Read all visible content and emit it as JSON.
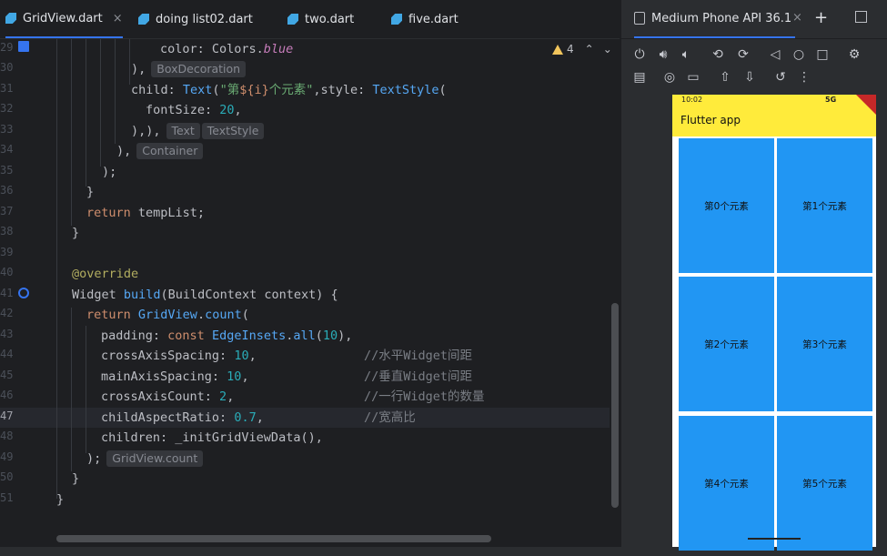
{
  "editor_tabs": [
    {
      "label": "GridView.dart",
      "active": true,
      "close": "×"
    },
    {
      "label": "doing list02.dart",
      "active": false
    },
    {
      "label": "two.dart",
      "active": false
    },
    {
      "label": "five.dart",
      "active": false
    }
  ],
  "warnings": {
    "count": "4"
  },
  "code": {
    "line_numbers": [
      "29",
      "30",
      "31",
      "32",
      "33",
      "34",
      "35",
      "36",
      "37",
      "38",
      "39",
      "40",
      "41",
      "42",
      "43",
      "44",
      "45",
      "46",
      "47",
      "48",
      "49",
      "50",
      "51"
    ],
    "current_line": "47",
    "hints": {
      "box_decoration": "BoxDecoration",
      "text": "Text",
      "text_style": "TextStyle",
      "container": "Container",
      "gridview_count": "GridView.count"
    },
    "l29": {
      "a": "color: Colors.",
      "b": "blue"
    },
    "l30": {
      "a": "),"
    },
    "l31": {
      "a": "child: ",
      "b": "Text",
      "c": "(",
      "d": "\"第",
      "e": "${i}",
      "f": "个元素\"",
      "g": ",style: ",
      "h": "TextStyle",
      "i": "("
    },
    "l32": {
      "a": "fontSize: ",
      "b": "20",
      "c": ","
    },
    "l33": {
      "a": "),),"
    },
    "l34": {
      "a": "),"
    },
    "l35": {
      "a": ");"
    },
    "l36": {
      "a": "}"
    },
    "l37": {
      "a": "return",
      "b": " tempList;"
    },
    "l38": {
      "a": "}"
    },
    "l40": {
      "a": "@override"
    },
    "l41": {
      "a": "Widget ",
      "b": "build",
      "c": "(BuildContext context) {"
    },
    "l42": {
      "a": "return ",
      "b": "GridView",
      "c": ".",
      "d": "count",
      "e": "("
    },
    "l43": {
      "a": "padding: ",
      "b": "const ",
      "c": "EdgeInsets",
      "d": ".",
      "e": "all",
      "f": "(",
      "g": "10",
      "h": "),"
    },
    "l44": {
      "a": "crossAxisSpacing: ",
      "b": "10",
      "c": ",",
      "d": "//水平Widget间距"
    },
    "l45": {
      "a": "mainAxisSpacing: ",
      "b": "10",
      "c": ",",
      "d": "//垂直Widget间距"
    },
    "l46": {
      "a": "crossAxisCount: ",
      "b": "2",
      "c": ",",
      "d": "//一行Widget的数量"
    },
    "l47": {
      "a": "childAspectRatio: ",
      "b": "0.7",
      "c": ",",
      "d": "//宽高比"
    },
    "l48": {
      "a": "children: _initGridViewData(),"
    },
    "l49": {
      "a": ");"
    },
    "l50": {
      "a": "}"
    },
    "l51": {
      "a": "}"
    }
  },
  "device_panel": {
    "title": "Medium Phone API 36.1",
    "close": "×",
    "add": "+",
    "toolbar_row1_icons": [
      "power-icon",
      "volume-up-icon",
      "volume-down-icon",
      "rotate-left-icon",
      "rotate-right-icon",
      "back-icon",
      "home-icon",
      "overview-icon",
      "snapshot-settings-icon"
    ],
    "toolbar_row2_icons": [
      "display-settings-icon",
      "camera-icon",
      "record-icon",
      "upload-icon",
      "download-icon",
      "reset-icon",
      "more-icon"
    ]
  },
  "phone": {
    "time": "10:02",
    "signal": "5G",
    "debug_banner": "DEBUG",
    "app_title": "Flutter app",
    "grid_items": [
      "第0个元素",
      "第1个元素",
      "第2个元素",
      "第3个元素",
      "第4个元素",
      "第5个元素"
    ]
  },
  "colors": {
    "accent": "#3574f0",
    "appbar": "#ffeb3b",
    "grid_tile": "#2196f3",
    "editor_bg": "#1e1f22"
  }
}
